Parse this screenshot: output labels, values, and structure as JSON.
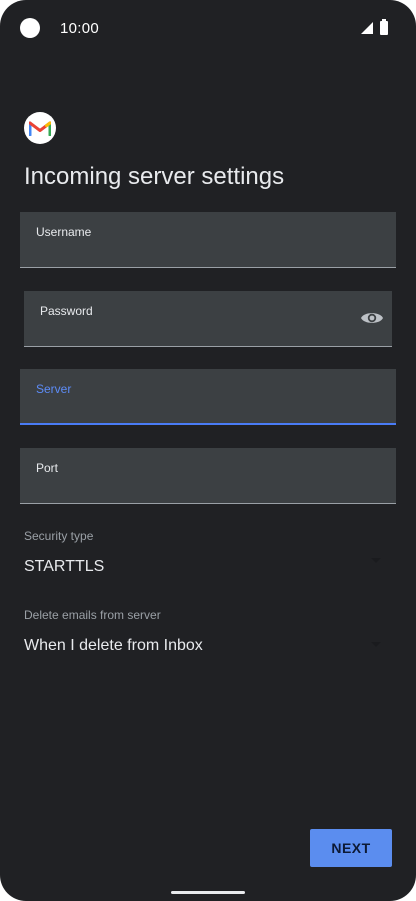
{
  "status_bar": {
    "time": "10:00"
  },
  "app": {
    "logo": "gmail-logo-icon"
  },
  "header": {
    "title": "Incoming server settings"
  },
  "form": {
    "username": {
      "label": "Username",
      "value": ""
    },
    "password": {
      "label": "Password",
      "value": "",
      "toggle_icon": "eye-icon"
    },
    "server": {
      "label": "Server",
      "value": "",
      "focused": true
    },
    "port": {
      "label": "Port",
      "value": ""
    },
    "security_type": {
      "label": "Security type",
      "value": "STARTTLS"
    },
    "delete_emails": {
      "label": "Delete emails from server",
      "value": "When I delete from Inbox"
    }
  },
  "actions": {
    "next_label": "NEXT"
  },
  "colors": {
    "background": "#202124",
    "field_bg": "#3c4043",
    "accent": "#4a7cf6",
    "button": "#5b8def",
    "text_primary": "#e8eaed",
    "text_secondary": "#9aa0a6"
  }
}
